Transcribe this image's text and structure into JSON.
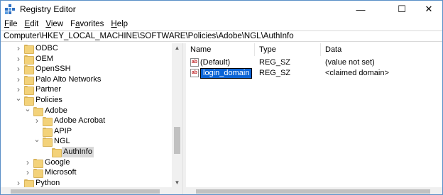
{
  "window": {
    "title": "Registry Editor",
    "controls": {
      "minimize": "—",
      "maximize": "☐",
      "close": "✕"
    }
  },
  "menu": [
    {
      "label": "File",
      "mnemonic": "F",
      "rest": "ile"
    },
    {
      "label": "Edit",
      "mnemonic": "E",
      "rest": "dit"
    },
    {
      "label": "View",
      "mnemonic": "V",
      "rest": "iew"
    },
    {
      "label": "Favorites",
      "mnemonic": "a",
      "before": "F",
      "rest": "vorites"
    },
    {
      "label": "Help",
      "mnemonic": "H",
      "rest": "elp"
    }
  ],
  "address": "Computer\\HKEY_LOCAL_MACHINE\\SOFTWARE\\Policies\\Adobe\\NGL\\AuthInfo",
  "tree": [
    {
      "label": "ODBC",
      "level": 0,
      "expander": ">"
    },
    {
      "label": "OEM",
      "level": 0,
      "expander": ">"
    },
    {
      "label": "OpenSSH",
      "level": 0,
      "expander": ">"
    },
    {
      "label": "Palo Alto Networks",
      "level": 0,
      "expander": ">"
    },
    {
      "label": "Partner",
      "level": 0,
      "expander": ">"
    },
    {
      "label": "Policies",
      "level": 0,
      "expander": "v"
    },
    {
      "label": "Adobe",
      "level": 1,
      "expander": "v"
    },
    {
      "label": "Adobe Acrobat",
      "level": 2,
      "expander": ">"
    },
    {
      "label": "APIP",
      "level": 2,
      "expander": ""
    },
    {
      "label": "NGL",
      "level": 2,
      "expander": "v"
    },
    {
      "label": "AuthInfo",
      "level": 3,
      "expander": "",
      "selected": true
    },
    {
      "label": "Google",
      "level": 1,
      "expander": ">"
    },
    {
      "label": "Microsoft",
      "level": 1,
      "expander": ">"
    },
    {
      "label": "Python",
      "level": 0,
      "expander": ">"
    }
  ],
  "columns": {
    "name": "Name",
    "type": "Type",
    "data": "Data"
  },
  "values": [
    {
      "name": "(Default)",
      "type": "REG_SZ",
      "data": "(value not set)",
      "icon": "ab",
      "editing": false
    },
    {
      "name": "login_domain",
      "type": "REG_SZ",
      "data": "<claimed domain>",
      "icon": "ab",
      "editing": true
    }
  ],
  "colors": {
    "accent": "#0a64d6",
    "selection": "#d9d9d9",
    "folder": "#f3d27a",
    "border": "#5a8fc7"
  }
}
